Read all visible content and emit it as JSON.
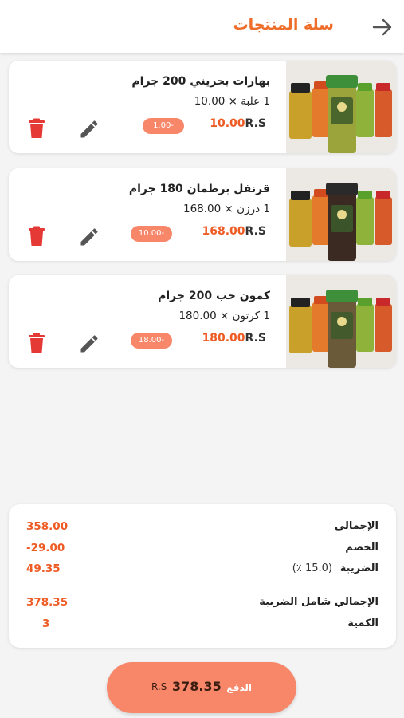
{
  "header": {
    "title": "سلة المنتجات",
    "back_icon": "arrow-right-icon"
  },
  "colors": {
    "accent": "#ee6d2a",
    "price": "#ee5c25",
    "badge": "#f8876a",
    "delete": "#e53935",
    "edit": "#555555"
  },
  "products": [
    {
      "name": "بهارات بحريني 200 جرام",
      "quantity": "1 علبة × 10.00",
      "price": "10.00",
      "currency": "R.S",
      "discount": "-1.00",
      "jar_color": "#9aa43a",
      "lid_color": "#3e8f3a"
    },
    {
      "name": "قرنفل برطمان 180 جرام",
      "quantity": "1 درزن × 168.00",
      "price": "168.00",
      "currency": "R.S",
      "discount": "-10.00",
      "jar_color": "#3b2a22",
      "lid_color": "#2a2a2a"
    },
    {
      "name": "كمون حب 200 جرام",
      "quantity": "1 كرتون × 180.00",
      "price": "180.00",
      "currency": "R.S",
      "discount": "-18.00",
      "jar_color": "#6b5a3a",
      "lid_color": "#3e8f3a"
    }
  ],
  "summary": {
    "total_label": "الإجمالي",
    "total_value": "358.00",
    "discount_label": "الخصم",
    "discount_value": "-29.00",
    "tax_label": "الضريبة",
    "tax_rate": "(15.0 ٪)",
    "tax_value": "49.35",
    "grand_label": "الإجمالي شامل الضريبة",
    "grand_value": "378.35",
    "qty_label": "الكمية",
    "qty_value": "3"
  },
  "pay_button": {
    "label": "الدفع",
    "amount": "378.35",
    "currency": "R.S"
  }
}
